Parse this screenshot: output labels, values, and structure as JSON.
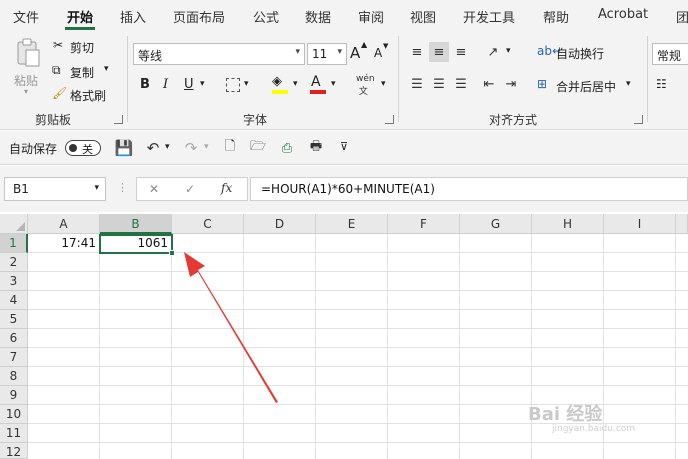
{
  "menu": {
    "tabs": [
      "文件",
      "开始",
      "插入",
      "页面布局",
      "公式",
      "数据",
      "审阅",
      "视图",
      "开发工具",
      "帮助",
      "Acrobat",
      "团"
    ]
  },
  "ribbon": {
    "clipboard": {
      "paste_label": "粘贴",
      "cut_label": "剪切",
      "copy_label": "复制",
      "format_painter_label": "格式刷",
      "group_label": "剪贴板"
    },
    "font": {
      "font_name": "等线",
      "font_size": "11",
      "bold": "B",
      "italic": "I",
      "underline": "U",
      "grow": "A",
      "shrink": "A",
      "group_label": "字体",
      "highlight_color": "#ffff00",
      "font_color": "#e02020"
    },
    "alignment": {
      "wrap_label": "自动换行",
      "merge_label": "合并后居中",
      "group_label": "对齐方式"
    },
    "number": {
      "format": "常规"
    }
  },
  "qat": {
    "autosave_label": "自动保存",
    "autosave_state": "关"
  },
  "formula_bar": {
    "name_box": "B1",
    "fx_label": "fx",
    "cancel": "✕",
    "enter": "✓",
    "formula": "=HOUR(A1)*60+MINUTE(A1)"
  },
  "sheet": {
    "columns": [
      "A",
      "B",
      "C",
      "D",
      "E",
      "F",
      "G",
      "H",
      "I"
    ],
    "rows": [
      "1",
      "2",
      "3",
      "4",
      "5",
      "6",
      "7",
      "8",
      "9",
      "10",
      "11",
      "12"
    ],
    "cells": {
      "A1": "17:41",
      "B1": "1061"
    },
    "accent": "#217346"
  },
  "annotation": {
    "arrow_color": "#e53935"
  },
  "watermark": {
    "text": "Bai 经验",
    "sub": "jingyan.baidu.com"
  }
}
